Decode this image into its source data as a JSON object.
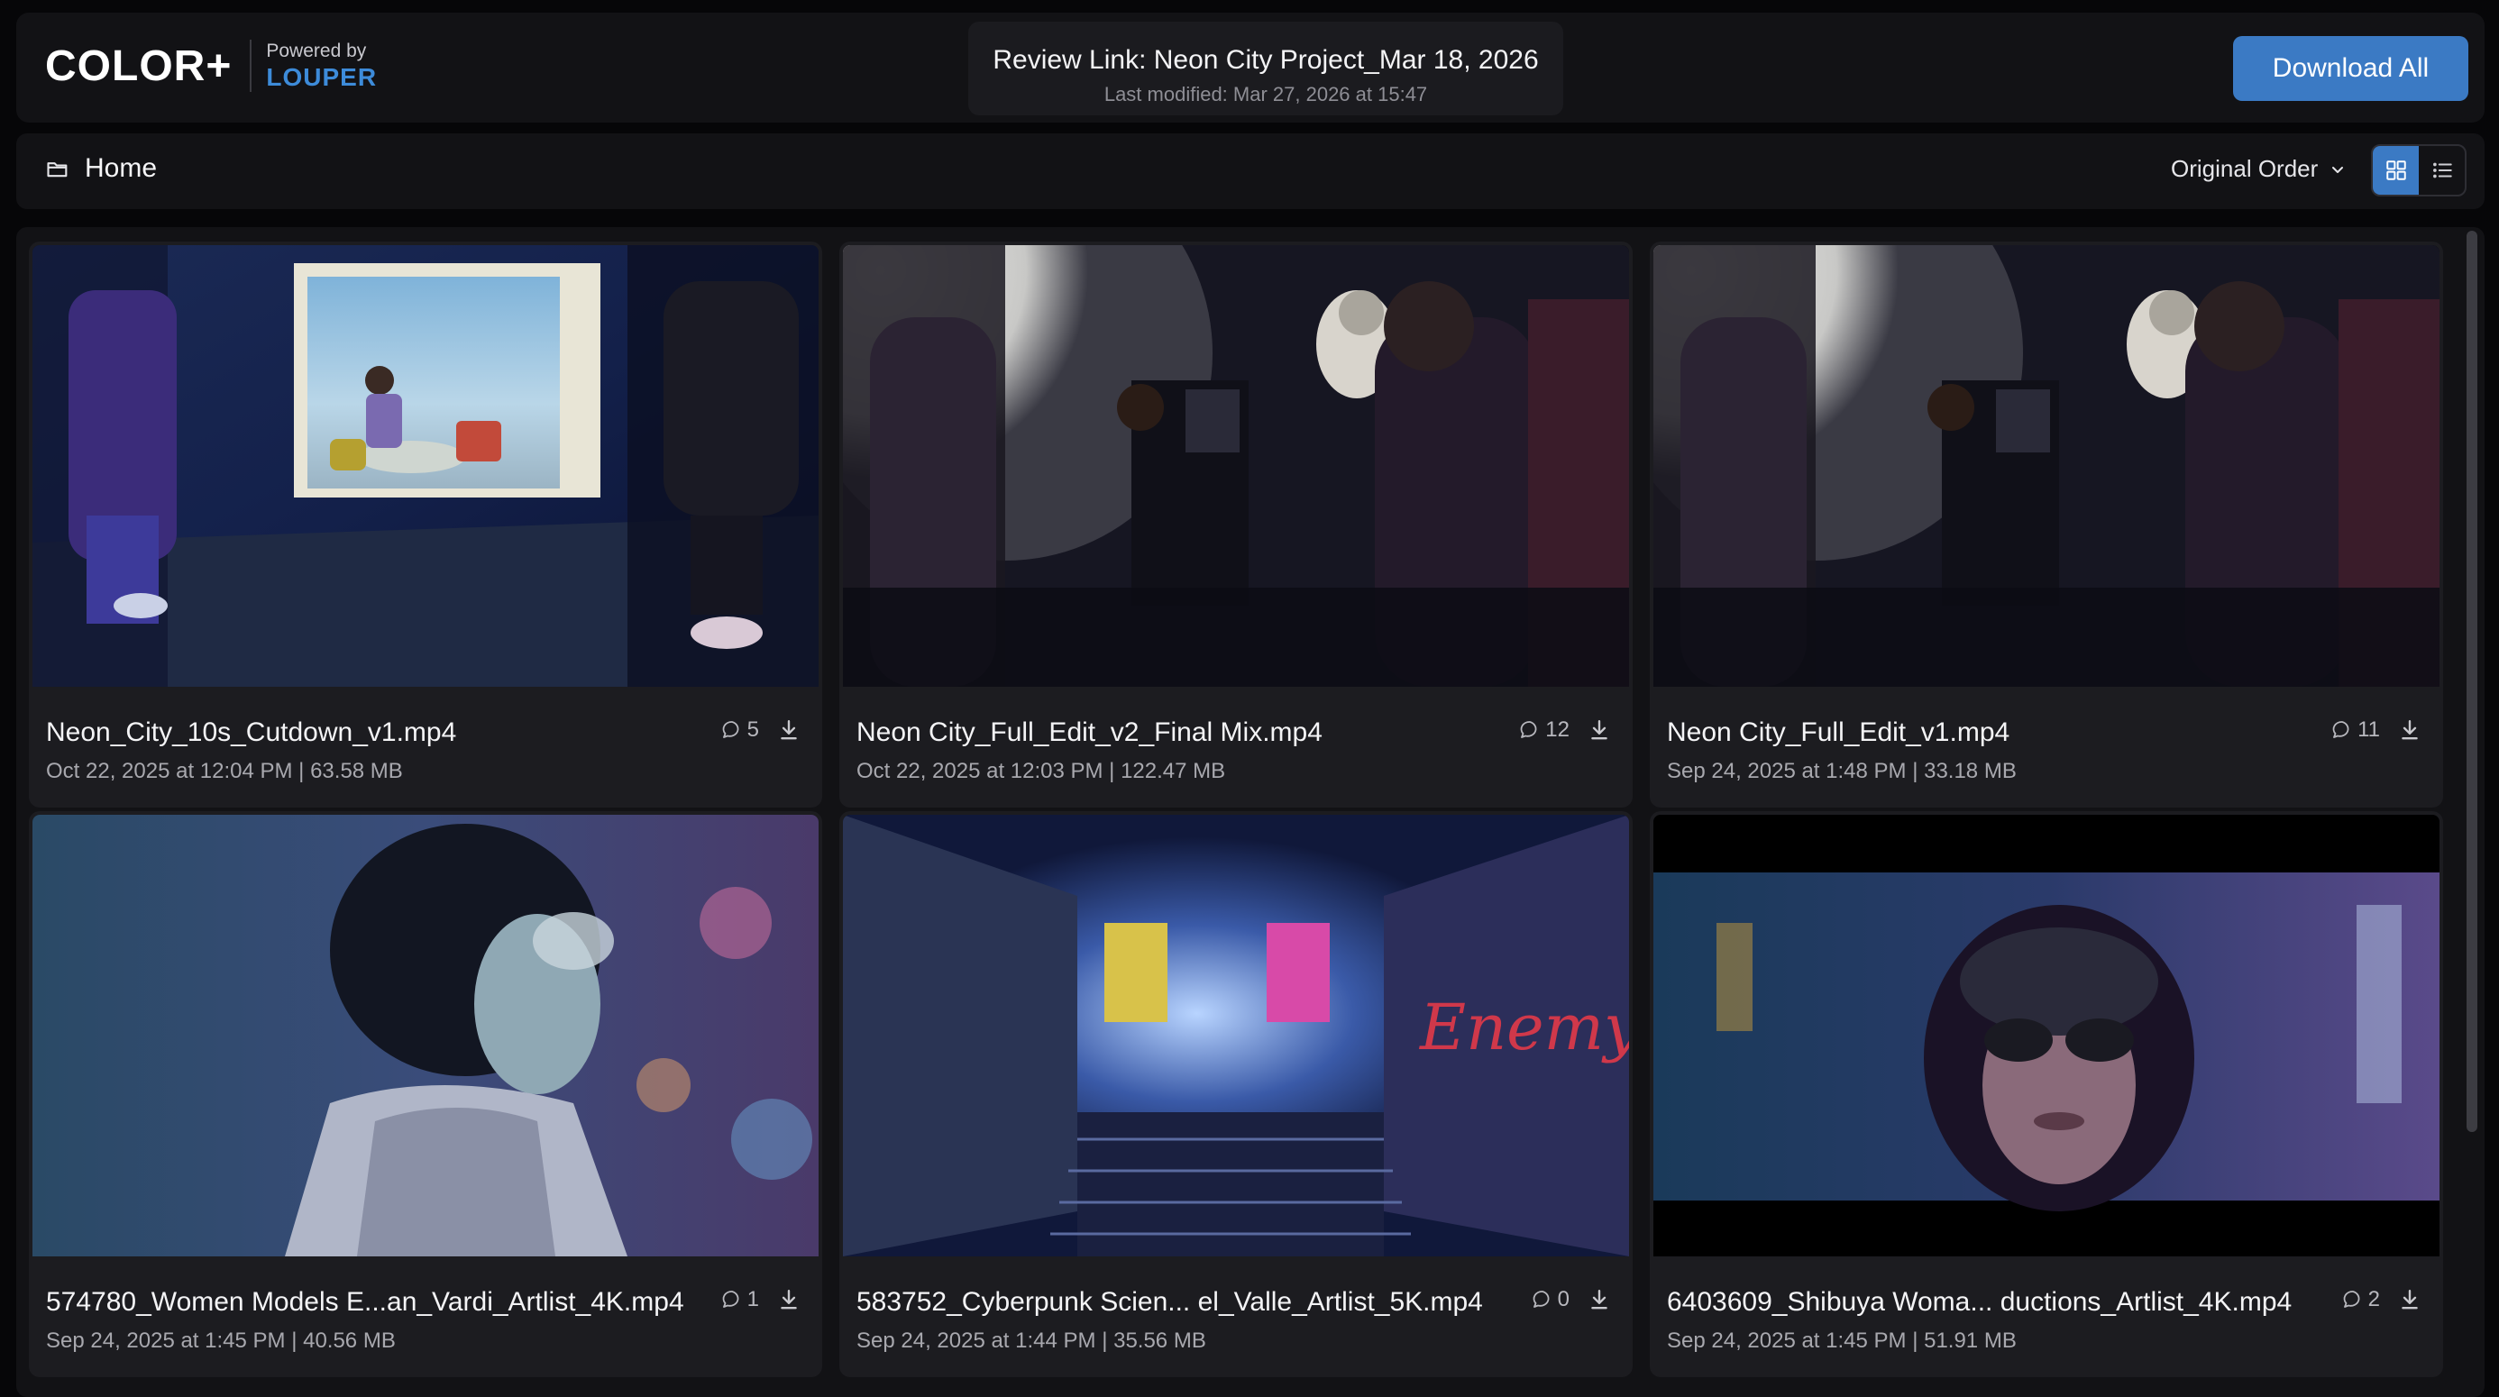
{
  "brand": {
    "logo": "COLOR+",
    "powered_by": "Powered by",
    "partner": "LOUPER"
  },
  "review": {
    "title": "Review Link: Neon City Project_Mar 18, 2026",
    "modified": "Last modified: Mar 27, 2026 at 15:47"
  },
  "toolbar": {
    "download_all": "Download All"
  },
  "nav": {
    "home": "Home",
    "sort": "Original Order",
    "view_mode": "grid"
  },
  "colors": {
    "accent": "#3b7ac4",
    "brand_partner": "#3d8bd9",
    "panel": "#121215",
    "card": "#1c1c20"
  },
  "assets": [
    {
      "name": "Neon_City_10s_Cutdown_v1.mp4",
      "meta": "Oct 22, 2025 at 12:04 PM | 63.58 MB",
      "comments": "5",
      "thumb": "storefront-scene"
    },
    {
      "name": "Neon City_Full_Edit_v2_Final Mix.mp4",
      "meta": "Oct 22, 2025 at 12:03 PM | 122.47 MB",
      "comments": "12",
      "thumb": "astronaut-window-scene"
    },
    {
      "name": "Neon City_Full_Edit_v1.mp4",
      "meta": "Sep 24, 2025 at 1:48 PM | 33.18 MB",
      "comments": "11",
      "thumb": "astronaut-window-scene"
    },
    {
      "name": "574780_Women Models E...an_Vardi_Artlist_4K.mp4",
      "meta": "Sep 24, 2025 at 1:45 PM | 40.56 MB",
      "comments": "1",
      "thumb": "woman-night-street"
    },
    {
      "name": "583752_Cyberpunk Scien... el_Valle_Artlist_5K.mp4",
      "meta": "Sep 24, 2025 at 1:44 PM | 35.56 MB",
      "comments": "0",
      "thumb": "graffiti-stairway"
    },
    {
      "name": "6403609_Shibuya Woma... ductions_Artlist_4K.mp4",
      "meta": "Sep 24, 2025 at 1:45 PM | 51.91 MB",
      "comments": "2",
      "thumb": "hooded-woman-sunglasses"
    }
  ]
}
